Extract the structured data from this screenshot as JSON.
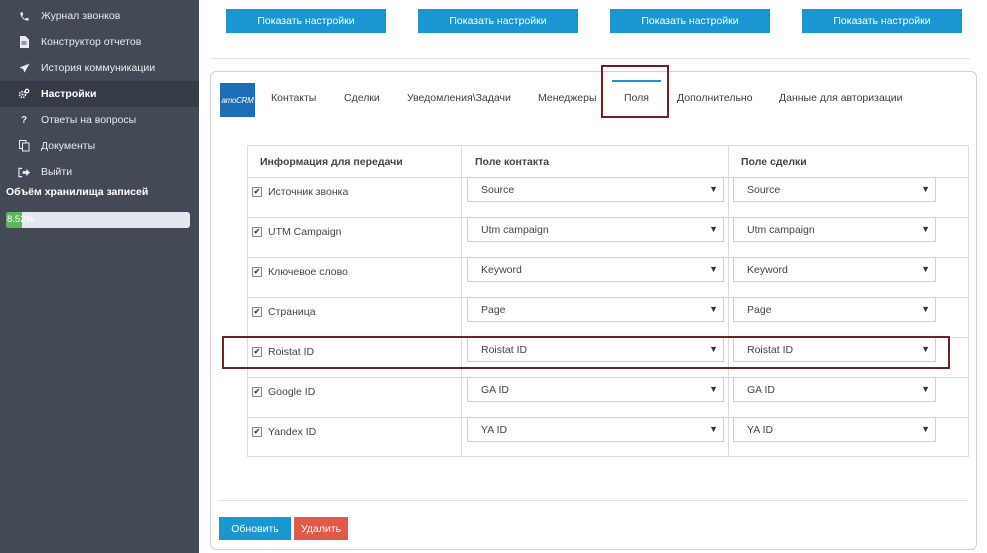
{
  "sidebar": {
    "items": [
      {
        "label": "Журнал звонков",
        "icon": "phone-icon"
      },
      {
        "label": "Конструктор отчетов",
        "icon": "document-icon"
      },
      {
        "label": "История коммуникации",
        "icon": "send-icon"
      },
      {
        "label": "Настройки",
        "icon": "gears-icon"
      },
      {
        "label": "Ответы на вопросы",
        "icon": "question-icon"
      },
      {
        "label": "Документы",
        "icon": "copy-icon"
      },
      {
        "label": "Выйти",
        "icon": "logout-icon"
      }
    ],
    "storage": {
      "label": "Объём хранилища записей",
      "percent_text": "8.52%",
      "percent": 8.52
    },
    "colors": {
      "bg": "#434a55",
      "active": "#363c45",
      "progress": "#5cb85c"
    }
  },
  "top_buttons": [
    "Показать настройки",
    "Показать настройки",
    "Показать настройки",
    "Показать настройки"
  ],
  "tabs": {
    "logo_text": "amoCRM",
    "items": [
      "Контакты",
      "Сделки",
      "Уведомления\\Задачи",
      "Менеджеры",
      "Поля",
      "Дополнительно",
      "Данные для авторизации"
    ],
    "active": "Поля"
  },
  "table": {
    "headers": [
      "Информация для передачи",
      "Поле контакта",
      "Поле сделки"
    ],
    "rows": [
      {
        "label": "Источник звонка",
        "checked": true,
        "contact": "Source",
        "deal": "Source"
      },
      {
        "label": "UTM Campaign",
        "checked": true,
        "contact": "Utm campaign",
        "deal": "Utm campaign"
      },
      {
        "label": "Ключевое слово",
        "checked": true,
        "contact": "Keyword",
        "deal": "Keyword"
      },
      {
        "label": "Страница",
        "checked": true,
        "contact": "Page",
        "deal": "Page"
      },
      {
        "label": "Roistat ID",
        "checked": true,
        "contact": "Roistat ID",
        "deal": "Roistat ID"
      },
      {
        "label": "Google ID",
        "checked": true,
        "contact": "GA ID",
        "deal": "GA ID"
      },
      {
        "label": "Yandex ID",
        "checked": true,
        "contact": "YA ID",
        "deal": "YA ID"
      }
    ]
  },
  "actions": {
    "update": "Обновить",
    "delete": "Удалить"
  },
  "colors": {
    "primary": "#1a96d1",
    "danger": "#e05a4c",
    "highlight": "#731e22"
  }
}
